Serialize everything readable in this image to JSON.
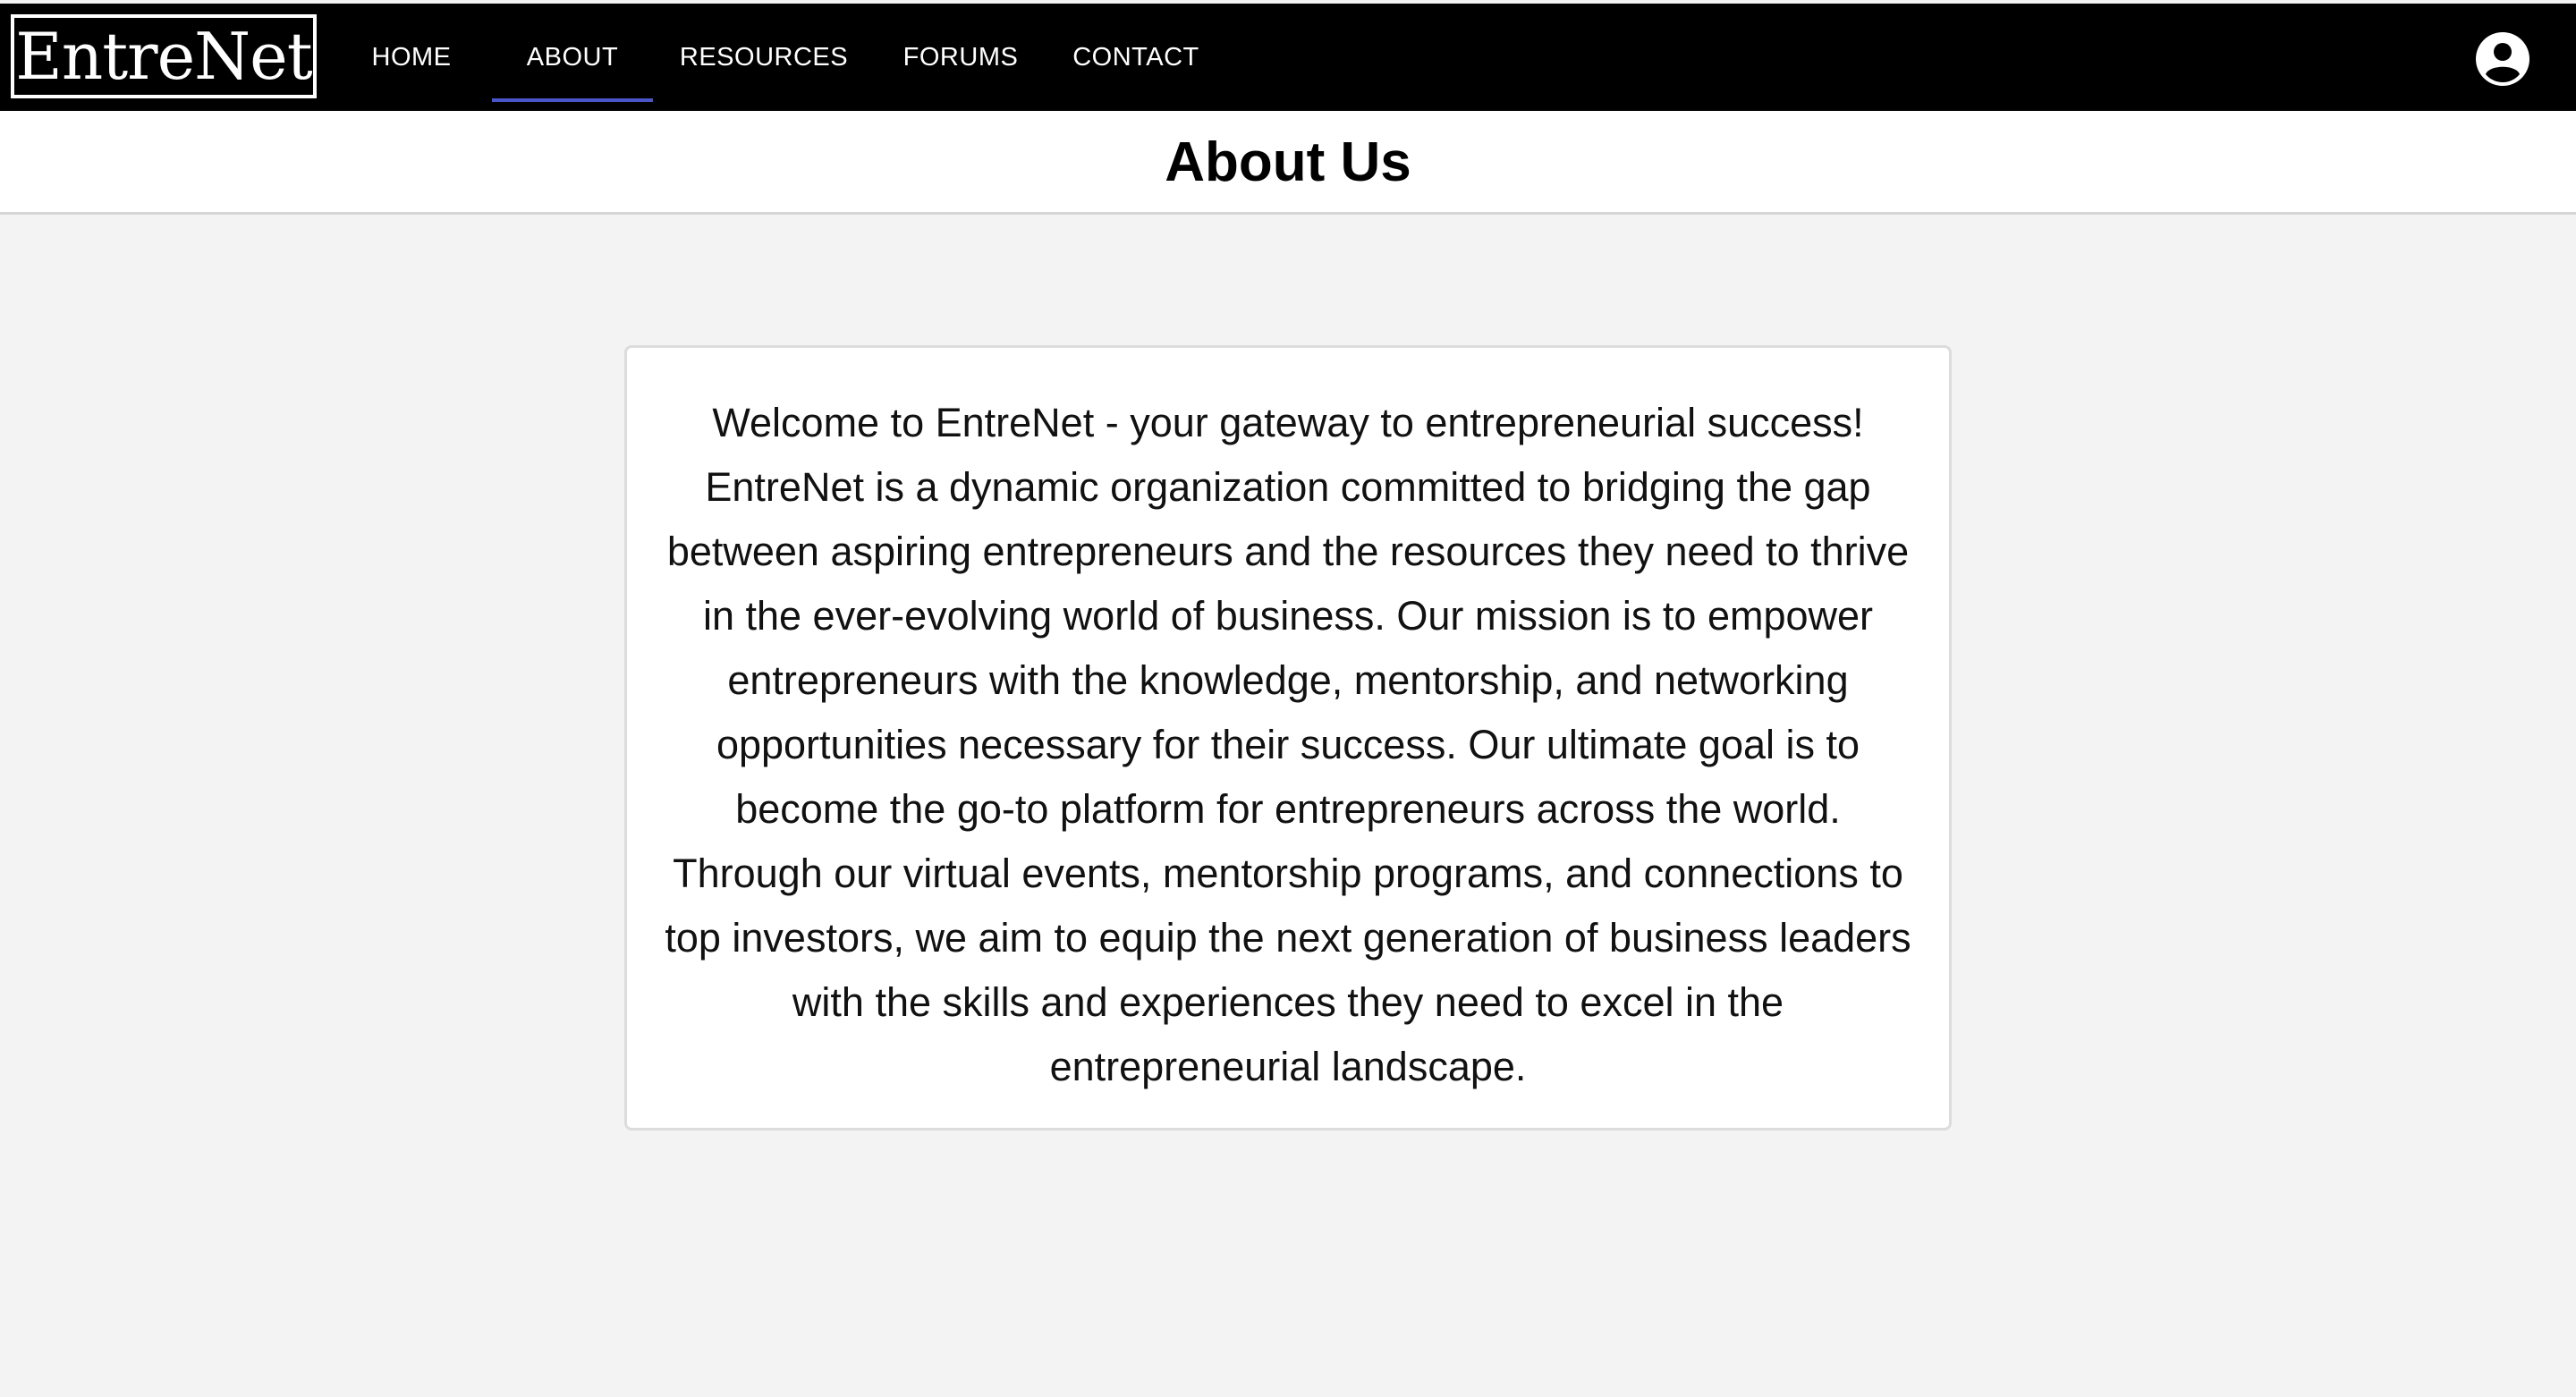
{
  "brand": {
    "logo_text": "EntreNet"
  },
  "nav": {
    "items": [
      {
        "label": "HOME"
      },
      {
        "label": "ABOUT"
      },
      {
        "label": "RESOURCES"
      },
      {
        "label": "FORUMS"
      },
      {
        "label": "CONTACT"
      }
    ],
    "active": "ABOUT"
  },
  "icons": {
    "profile": "account-circle-icon"
  },
  "colors": {
    "nav_background": "#000000",
    "active_underline": "#4a55c9",
    "page_background": "#f3f3f3"
  },
  "page": {
    "title": "About Us"
  },
  "about": {
    "text": "Welcome to EntreNet - your gateway to entrepreneurial success! EntreNet is a dynamic organization committed to bridging the gap between aspiring entrepreneurs and the resources they need to thrive in the ever-evolving world of business. Our mission is to empower entrepreneurs with the knowledge, mentorship, and networking opportunities necessary for their success. Our ultimate goal is to become the go-to platform for entrepreneurs across the world. Through our virtual events, mentorship programs, and connections to top investors, we aim to equip the next generation of business leaders with the skills and experiences they need to excel in the entrepreneurial landscape."
  }
}
